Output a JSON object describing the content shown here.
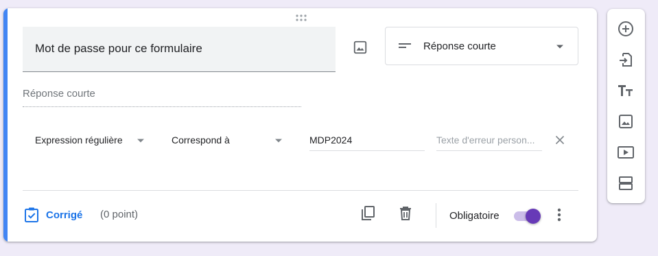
{
  "question": {
    "title": "Mot de passe pour ce formulaire",
    "type_label": "Réponse courte",
    "answer_placeholder": "Réponse courte"
  },
  "validation": {
    "rule_type": "Expression régulière",
    "rule_condition": "Correspond à",
    "pattern_value": "MDP2024",
    "error_placeholder": "Texte d'erreur person..."
  },
  "footer": {
    "answer_key_label": "Corrigé",
    "points_label": "(0 point)",
    "required_label": "Obligatoire",
    "required_on": true
  },
  "side_toolbar": {
    "items": [
      "add-question-icon",
      "import-questions-icon",
      "title-text-icon",
      "add-image-icon",
      "add-video-icon",
      "add-section-icon"
    ]
  },
  "colors": {
    "accent_blue": "#4285f4",
    "link_blue": "#1a73e8",
    "toggle_purple": "#673ab7",
    "background": "#efebf8"
  }
}
